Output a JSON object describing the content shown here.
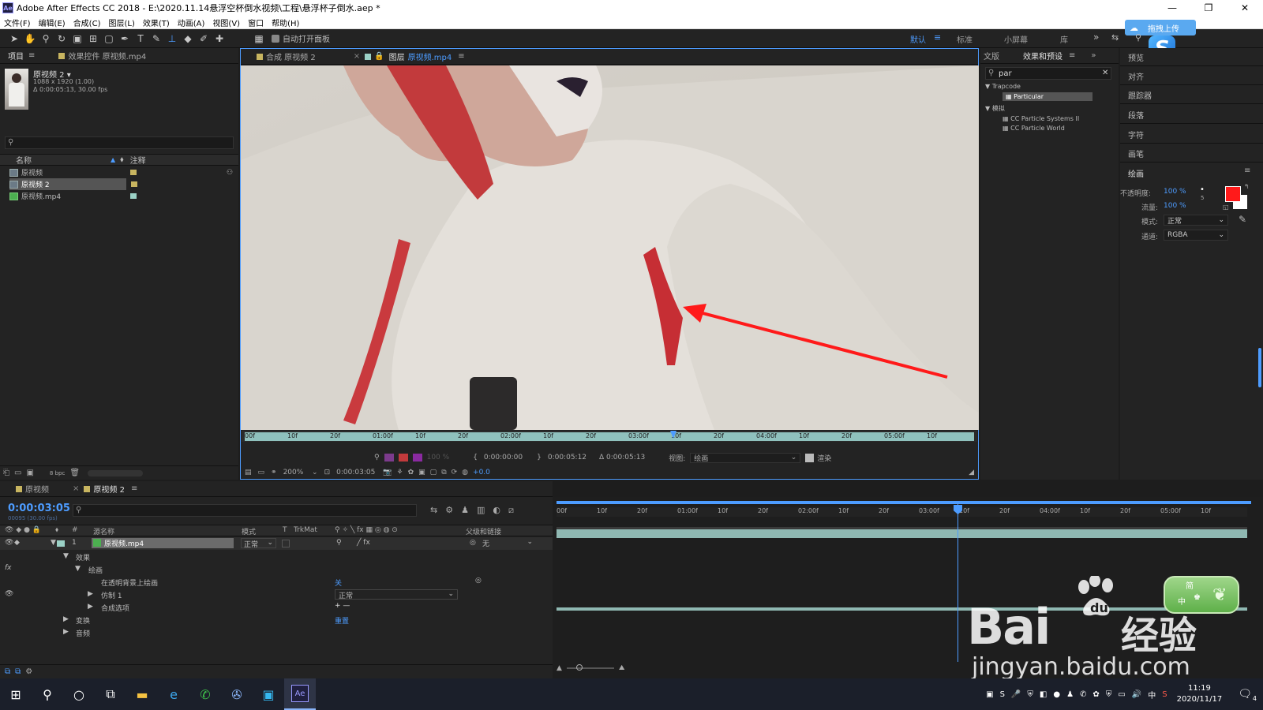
{
  "window": {
    "title": "Adobe After Effects CC 2018 - E:\\2020.11.14悬浮空杯倒水视频\\工程\\悬浮杯子倒水.aep *",
    "app_logo": "Ae"
  },
  "menu": [
    "文件(F)",
    "编辑(E)",
    "合成(C)",
    "图层(L)",
    "效果(T)",
    "动画(A)",
    "视图(V)",
    "窗口",
    "帮助(H)"
  ],
  "toolbar": {
    "auto_open_label": "自动打开面板",
    "workspaces": [
      "默认",
      "标准",
      "小屏幕",
      "库"
    ],
    "upload_label": "拖拽上传"
  },
  "project_panel": {
    "tab_project": "项目",
    "tab_effects": "效果控件 原视频.mp4",
    "asset_name": "原视频 2",
    "asset_dims": "1088 x 1920 (1.00)",
    "asset_duration": "Δ 0:00:05:13, 30.00 fps",
    "col_name": "名称",
    "col_comment": "注释",
    "items": [
      {
        "name": "原视频",
        "color": "#c8b560",
        "type": "comp"
      },
      {
        "name": "原视频 2",
        "color": "#c8b560",
        "type": "comp"
      },
      {
        "name": "原视频.mp4",
        "color": "#9bd1c6",
        "type": "footage"
      }
    ],
    "bpc": "8 bpc"
  },
  "viewer": {
    "tab1": "合成 原视频 2",
    "tab2_prefix": "图层",
    "tab2_name": "原视频.mp4",
    "ruler_ticks": [
      "00f",
      "10f",
      "20f",
      "01:00f",
      "10f",
      "20f",
      "02:00f",
      "10f",
      "20f",
      "03:00f",
      "10f",
      "20f",
      "04:00f",
      "10f",
      "20f",
      "05:00f",
      "10f"
    ],
    "in_time": "0:00:00:00",
    "out_time": "0:00:05:12",
    "duration": "Δ 0:00:05:13",
    "view_label": "视图:",
    "view_value": "绘画",
    "render_label": "渲染",
    "zoom": "200%",
    "current_time": "0:00:03:05",
    "exposure": "+0.0",
    "opacity_disabled": "100 %"
  },
  "effects_panel": {
    "tab_text": "文版",
    "tab_effects": "效果和预设",
    "search_value": "par",
    "groups": [
      {
        "name": "Trapcode",
        "items": [
          "Particular"
        ]
      },
      {
        "name": "模拟",
        "items": [
          "CC Particle Systems II",
          "CC Particle World"
        ]
      }
    ]
  },
  "right_panels": {
    "items": [
      "预览",
      "对齐",
      "跟踪器",
      "段落",
      "字符",
      "画笔"
    ],
    "paint_title": "绘画",
    "opacity_label": "不透明度:",
    "opacity_value": "100 %",
    "flow_label": "流量:",
    "flow_value": "100 %",
    "mode_label": "模式:",
    "mode_value": "正常",
    "channel_label": "通道:",
    "channel_value": "RGBA",
    "brush_size": "5",
    "fg_color": "#ff1a1a",
    "bg_color": "#ffffff"
  },
  "timeline": {
    "tab1": "原视频",
    "tab2": "原视频 2",
    "current_time": "0:00:03:05",
    "frame_info": "00095 (30.00 fps)",
    "col_source": "源名称",
    "col_mode": "模式",
    "col_t": "T",
    "col_trkmat": "TrkMat",
    "col_parent": "父级和链接",
    "layer_num": "1",
    "layer_name": "原视频.mp4",
    "layer_mode": "正常",
    "layer_parent": "无",
    "props": [
      {
        "name": "效果",
        "indent": 1,
        "expand": true
      },
      {
        "name": "绘画",
        "indent": 2,
        "expand": true
      },
      {
        "name": "在透明背景上绘画",
        "indent": 3,
        "value": "关"
      },
      {
        "name": "仿制 1",
        "indent": 3,
        "expand": false,
        "value": "正常"
      },
      {
        "name": "合成选项",
        "indent": 3,
        "expand": false,
        "value": "+ —"
      },
      {
        "name": "变换",
        "indent": 1,
        "expand": false,
        "value": "重置"
      },
      {
        "name": "音频",
        "indent": 1,
        "expand": false
      }
    ],
    "ruler_ticks": [
      "00f",
      "10f",
      "20f",
      "01:00f",
      "10f",
      "20f",
      "02:00f",
      "10f",
      "20f",
      "03:00f",
      "10f",
      "20f",
      "04:00f",
      "10f",
      "20f",
      "05:00f",
      "10f"
    ]
  },
  "watermark": {
    "brand": "Bai",
    "brand2": "经验",
    "url": "jingyan.baidu.com",
    "lang1": "简",
    "lang2": "中"
  },
  "taskbar": {
    "time": "11:19",
    "date": "2020/11/17",
    "ime": "中",
    "notif": "4"
  }
}
